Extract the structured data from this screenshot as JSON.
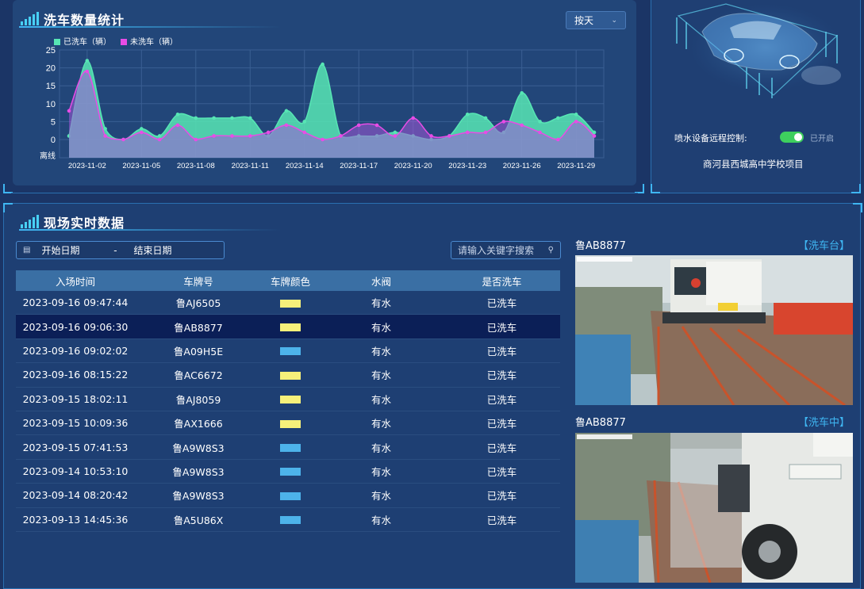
{
  "chart_panel": {
    "title": "洗车数量统计",
    "period_select": "按天"
  },
  "chart_data": {
    "type": "area",
    "title": "洗车数量统计",
    "legend": [
      "已洗车（辆）",
      "未洗车（辆）"
    ],
    "legend_placement": "top-left",
    "x_ticks": [
      "2023-11-02",
      "2023-11-05",
      "2023-11-08",
      "2023-11-11",
      "2023-11-14",
      "2023-11-17",
      "2023-11-20",
      "2023-11-23",
      "2023-11-26",
      "2023-11-29"
    ],
    "y_ticks": [
      "25",
      "20",
      "15",
      "10",
      "5",
      "0"
    ],
    "y_extra_label": "离线",
    "ylim": [
      0,
      25
    ],
    "grid": true,
    "x": [
      "2023-11-01",
      "2023-11-02",
      "2023-11-03",
      "2023-11-04",
      "2023-11-05",
      "2023-11-06",
      "2023-11-07",
      "2023-11-08",
      "2023-11-09",
      "2023-11-10",
      "2023-11-11",
      "2023-11-12",
      "2023-11-13",
      "2023-11-14",
      "2023-11-15",
      "2023-11-16",
      "2023-11-17",
      "2023-11-18",
      "2023-11-19",
      "2023-11-20",
      "2023-11-21",
      "2023-11-22",
      "2023-11-23",
      "2023-11-24",
      "2023-11-25",
      "2023-11-26",
      "2023-11-27",
      "2023-11-28",
      "2023-11-29",
      "2023-11-30"
    ],
    "series": [
      {
        "name": "已洗车（辆）",
        "color": "#57e6b4",
        "values": [
          1,
          22,
          3,
          0,
          3,
          1,
          7,
          6,
          6,
          6,
          6,
          1,
          8,
          5,
          21,
          1,
          1,
          1,
          2,
          1,
          0,
          1,
          7,
          6,
          2,
          13,
          5,
          6,
          7,
          2
        ]
      },
      {
        "name": "未洗车（辆）",
        "color": "#e84ce6",
        "values": [
          8,
          19,
          1,
          0,
          2,
          0,
          4,
          0,
          1,
          1,
          1,
          2,
          4,
          2,
          0,
          1,
          4,
          4,
          1,
          6,
          1,
          1,
          2,
          2,
          5,
          4,
          2,
          0,
          5,
          1
        ]
      }
    ]
  },
  "device_panel": {
    "spray_label": "喷水设备远程控制:",
    "spray_state": "已开启",
    "project_name": "商河县西城高中学校项目"
  },
  "live_panel": {
    "title": "现场实时数据",
    "start_date": "开始日期",
    "date_sep": "-",
    "end_date": "结束日期",
    "search_placeholder": "请输入关键字搜索",
    "columns": [
      "入场时间",
      "车牌号",
      "车牌颜色",
      "水阀",
      "是否洗车"
    ],
    "rows": [
      {
        "time": "2023-09-16 09:47:44",
        "plate": "鲁AJ6505",
        "plate_color": "#f6f07a",
        "valve": "有水",
        "washed": "已洗车"
      },
      {
        "time": "2023-09-16 09:06:30",
        "plate": "鲁AB8877",
        "plate_color": "#f6f07a",
        "valve": "有水",
        "washed": "已洗车"
      },
      {
        "time": "2023-09-16 09:02:02",
        "plate": "鲁A09H5E",
        "plate_color": "#4db3ea",
        "valve": "有水",
        "washed": "已洗车"
      },
      {
        "time": "2023-09-16 08:15:22",
        "plate": "鲁AC6672",
        "plate_color": "#f6f07a",
        "valve": "有水",
        "washed": "已洗车"
      },
      {
        "time": "2023-09-15 18:02:11",
        "plate": "鲁AJ8059",
        "plate_color": "#f6f07a",
        "valve": "有水",
        "washed": "已洗车"
      },
      {
        "time": "2023-09-15 10:09:36",
        "plate": "鲁AX1666",
        "plate_color": "#f6f07a",
        "valve": "有水",
        "washed": "已洗车"
      },
      {
        "time": "2023-09-15 07:41:53",
        "plate": "鲁A9W8S3",
        "plate_color": "#4db3ea",
        "valve": "有水",
        "washed": "已洗车"
      },
      {
        "time": "2023-09-14 10:53:10",
        "plate": "鲁A9W8S3",
        "plate_color": "#4db3ea",
        "valve": "有水",
        "washed": "已洗车"
      },
      {
        "time": "2023-09-14 08:20:42",
        "plate": "鲁A9W8S3",
        "plate_color": "#4db3ea",
        "valve": "有水",
        "washed": "已洗车"
      },
      {
        "time": "2023-09-13 14:45:36",
        "plate": "鲁A5U86X",
        "plate_color": "#4db3ea",
        "valve": "有水",
        "washed": "已洗车"
      }
    ]
  },
  "cameras": [
    {
      "plate": "鲁AB8877",
      "status": "【洗车台】"
    },
    {
      "plate": "鲁AB8877",
      "status": "【洗车中】"
    }
  ],
  "colors": {
    "accent": "#3fb6f2",
    "washed": "#57e6b4",
    "unwashed": "#e84ce6",
    "toggle_on": "#3ecf5e"
  }
}
